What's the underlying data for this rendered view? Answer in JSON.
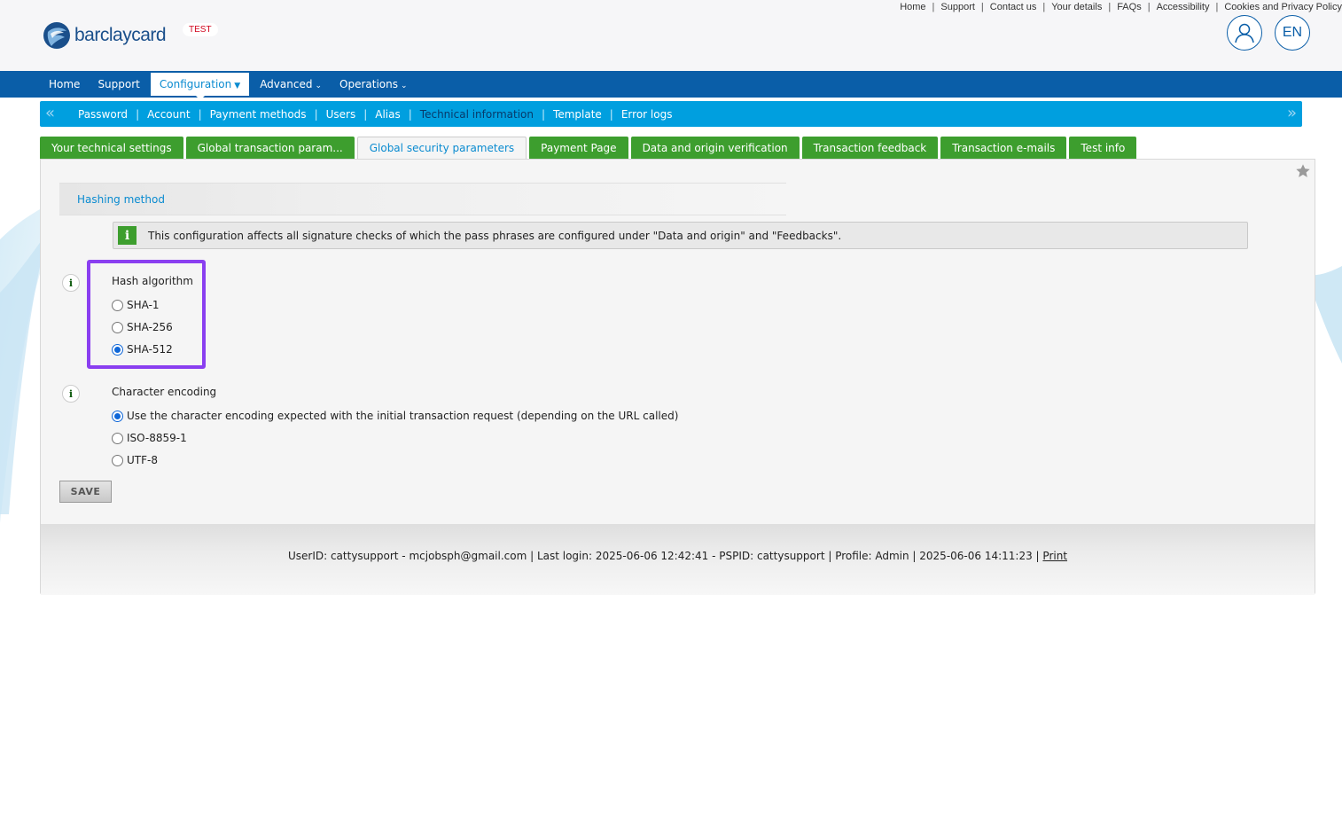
{
  "header": {
    "logo_text": "barclaycard",
    "env_badge": "TEST",
    "top_links": [
      "Home",
      "Support",
      "Contact us",
      "Your details",
      "FAQs",
      "Accessibility",
      "Cookies and Privacy Policy"
    ],
    "language": "EN"
  },
  "main_nav": {
    "items": [
      {
        "label": "Home"
      },
      {
        "label": "Support"
      },
      {
        "label": "Configuration",
        "active": true
      },
      {
        "label": "Advanced"
      },
      {
        "label": "Operations"
      }
    ]
  },
  "sub_nav": {
    "items": [
      "Password",
      "Account",
      "Payment methods",
      "Users",
      "Alias",
      "Technical information",
      "Template",
      "Error logs"
    ],
    "current": "Technical information"
  },
  "tabs": {
    "items": [
      "Your technical settings",
      "Global transaction param...",
      "Global security parameters",
      "Payment Page",
      "Data and origin verification",
      "Transaction feedback",
      "Transaction e-mails",
      "Test info"
    ],
    "active": "Global security parameters"
  },
  "section": {
    "title": "Hashing method",
    "info_message": "This configuration affects all signature checks of which the pass phrases are configured under \"Data and origin\" and \"Feedbacks\"."
  },
  "hash_algorithm": {
    "label": "Hash algorithm",
    "options": [
      "SHA-1",
      "SHA-256",
      "SHA-512"
    ],
    "selected": "SHA-512"
  },
  "character_encoding": {
    "label": "Character encoding",
    "options": [
      "Use the character encoding expected with the initial transaction request (depending on the URL called)",
      "ISO-8859-1",
      "UTF-8"
    ],
    "selected": "Use the character encoding expected with the initial transaction request (depending on the URL called)"
  },
  "save_label": "SAVE",
  "footer": {
    "text": "UserID: cattysupport - mcjobsph@gmail.com | Last login: 2025-06-06 12:42:41 - PSPID: cattysupport | Profile: Admin | 2025-06-06 14:11:23 |",
    "print_label": "Print"
  },
  "colors": {
    "brand_blue": "#0a5ea8",
    "subnav_blue": "#009fdf",
    "tab_green": "#3d9e2e",
    "highlight_purple": "#8a3ff0"
  }
}
